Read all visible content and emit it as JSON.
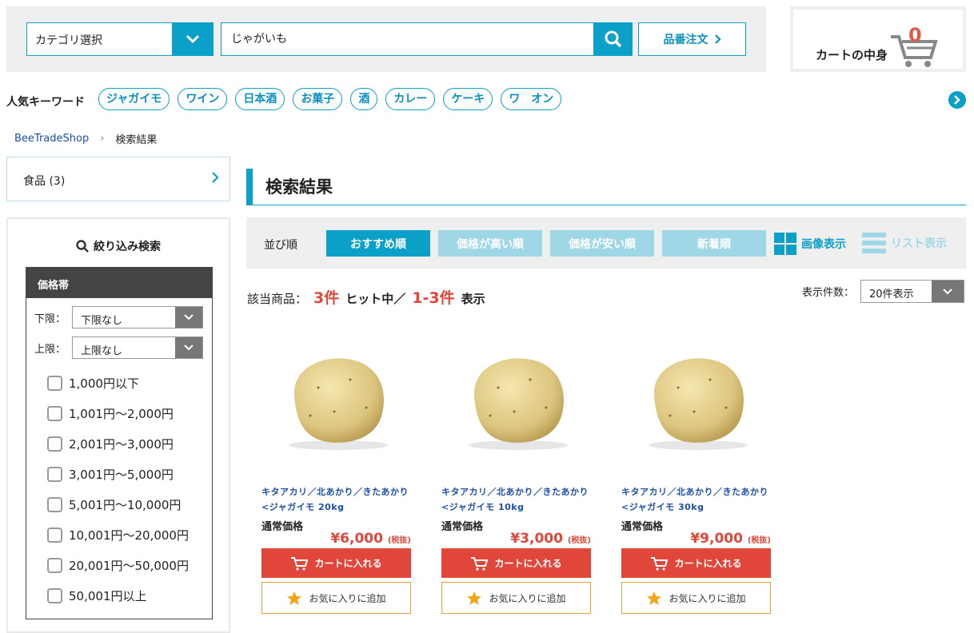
{
  "header": {
    "category_select": "カテゴリ選択",
    "search_value": "じゃがいも",
    "order_button": "品番注文",
    "cart_label": "カートの中身",
    "cart_count": "0"
  },
  "keywords": {
    "label": "人気キーワード",
    "items": [
      "ジャガイモ",
      "ワイン",
      "日本酒",
      "お菓子",
      "酒",
      "カレー",
      "ケーキ",
      "ワ　オン"
    ]
  },
  "breadcrumb": {
    "home": "BeeTradeShop",
    "current": "検索結果"
  },
  "sidebar": {
    "category": "食品 (3)",
    "filter_title": "絞り込み検索",
    "price_head": "価格帯",
    "lower_label": "下限：",
    "lower_value": "下限なし",
    "upper_label": "上限：",
    "upper_value": "上限なし",
    "ranges": [
      "1,000円以下",
      "1,001円〜2,000円",
      "2,001円〜3,000円",
      "3,001円〜5,000円",
      "5,001円〜10,000円",
      "10,001円〜20,000円",
      "20,001円〜50,000円",
      "50,001円以上"
    ]
  },
  "main": {
    "title": "検索結果",
    "sort_label": "並び順",
    "sort_options": [
      "おすすめ順",
      "価格が高い順",
      "価格が安い順",
      "新着順"
    ],
    "view_image": "画像表示",
    "view_list": "リスト表示",
    "count_prefix": "該当商品：",
    "count_total": "3件",
    "count_mid": "ヒット中／",
    "count_range": "1-3件",
    "count_suffix": "表示",
    "per_page_label": "表示件数：",
    "per_page_value": "20件表示"
  },
  "products": [
    {
      "name_line1": "キタアカリ／北あかり／きたあかり",
      "name_line2": "<ジャガイモ 20kg",
      "price_label": "通常価格",
      "price": "¥6,000",
      "tax": "(税抜)",
      "cart": "カートに入れる",
      "fav": "お気に入りに追加"
    },
    {
      "name_line1": "キタアカリ／北あかり／きたあかり",
      "name_line2": "<ジャガイモ 10kg",
      "price_label": "通常価格",
      "price": "¥3,000",
      "tax": "(税抜)",
      "cart": "カートに入れる",
      "fav": "お気に入りに追加"
    },
    {
      "name_line1": "キタアカリ／北あかり／きたあかり",
      "name_line2": "<ジャガイモ 30kg",
      "price_label": "通常価格",
      "price": "¥9,000",
      "tax": "(税抜)",
      "cart": "カートに入れる",
      "fav": "お気に入りに追加"
    }
  ],
  "colors": {
    "accent": "#0aa0c8",
    "price_red": "#e0463a",
    "fav_border": "#e8a23a"
  }
}
